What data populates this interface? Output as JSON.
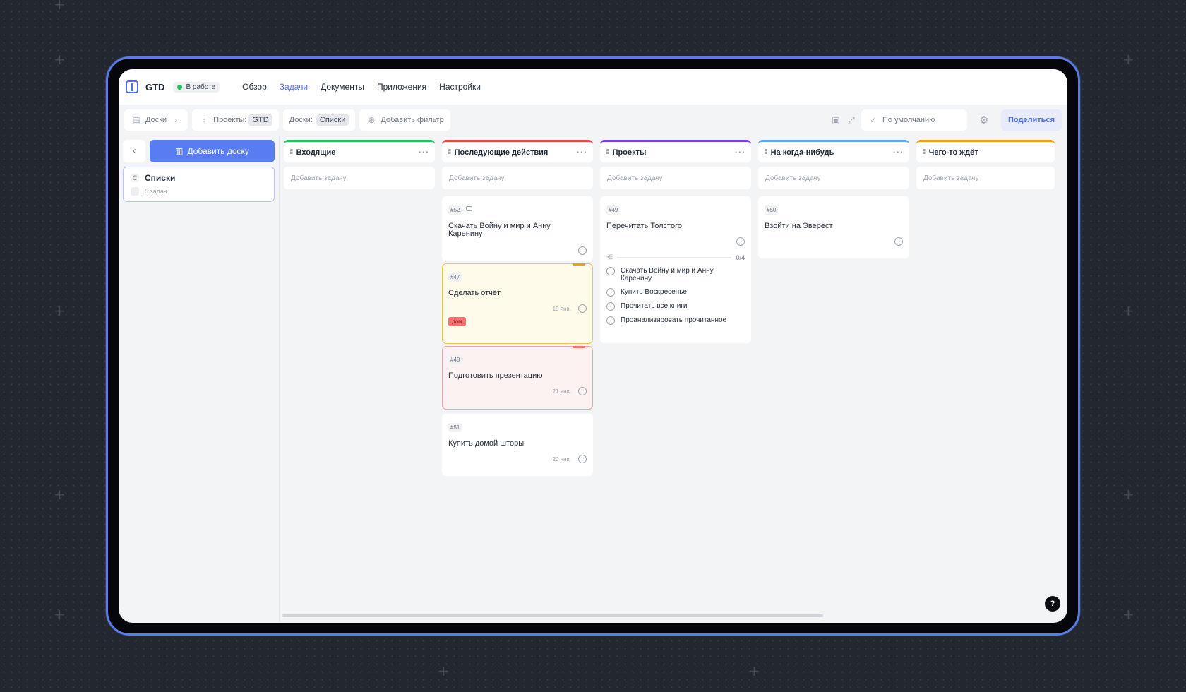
{
  "header": {
    "app_name": "GTD",
    "status": "В работе",
    "nav": [
      "Обзор",
      "Задачи",
      "Документы",
      "Приложения",
      "Настройки"
    ],
    "active_nav": "Задачи"
  },
  "toolbar": {
    "boards_breadcrumb": "Доски",
    "projects_label": "Проекты:",
    "projects_value": "GTD",
    "boards_label": "Доски:",
    "boards_value": "Списки",
    "add_filter": "Добавить фильтр",
    "view_default": "По умолчанию",
    "share": "Поделиться"
  },
  "sidebar": {
    "add_board": "Добавить доску",
    "board": {
      "initial": "С",
      "title": "Списки",
      "subtitle": "5 задач"
    }
  },
  "columns": [
    {
      "name": "Входящие",
      "color": "#22c55e",
      "add_task": "Добавить задачу"
    },
    {
      "name": "Последующие действия",
      "color": "#ef4444",
      "add_task": "Добавить задачу"
    },
    {
      "name": "Проекты",
      "color": "#7c3aed",
      "add_task": "Добавить задачу"
    },
    {
      "name": "На когда-нибудь",
      "color": "#60a5fa",
      "add_task": "Добавить задачу"
    },
    {
      "name": "Чего-то ждёт",
      "color": "#f59e0b",
      "add_task": "Добавить задачу"
    }
  ],
  "cards": {
    "c52": {
      "id": "#52",
      "title": "Скачать Войну и мир и Анну Каренину"
    },
    "c47": {
      "id": "#47",
      "title": "Сделать отчёт",
      "date": "19 янв.",
      "tag": "дом"
    },
    "c48": {
      "id": "#48",
      "title": "Подготовить презентацию",
      "date": "21 янв."
    },
    "c51": {
      "id": "#51",
      "title": "Купить домой шторы",
      "date": "20 янв."
    },
    "c49": {
      "id": "#49",
      "title": "Перечитать Толстого!",
      "progress": "0/4",
      "subtasks": [
        "Скачать Войну и мир и Анну Каренину",
        "Купить Воскресенье",
        "Прочитать все книги",
        "Проанализировать прочитанное"
      ]
    },
    "c50": {
      "id": "#50",
      "title": "Взойти на Эверест"
    }
  },
  "help": "?"
}
